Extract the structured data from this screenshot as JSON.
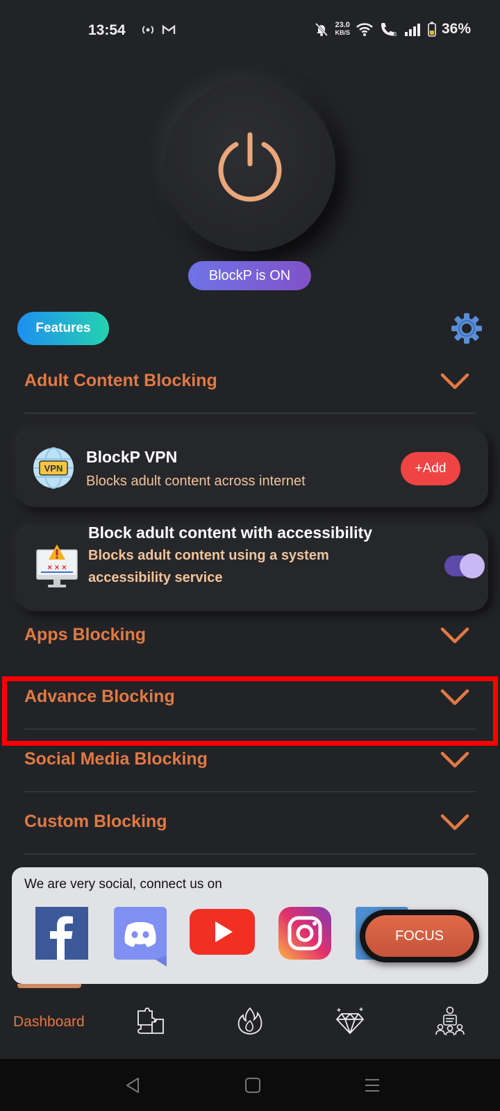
{
  "status_bar": {
    "time": "13:54",
    "left_icons": [
      "radio-icon",
      "gmail-icon"
    ],
    "speed_value": "23.0",
    "speed_unit": "KB/S",
    "battery": "36%",
    "right_icons": [
      "mute-icon",
      "wifi-icon",
      "wifi-calling-icon",
      "signal-icon",
      "battery-icon"
    ]
  },
  "hero": {
    "status_label": "BlockP is ON",
    "power_color": "#e9a77a"
  },
  "features": {
    "label": "Features"
  },
  "sections": [
    {
      "title": "Adult Content Blocking",
      "expanded": true
    },
    {
      "title": "Apps Blocking",
      "expanded": false
    },
    {
      "title": "Advance Blocking",
      "expanded": false,
      "highlighted": true
    },
    {
      "title": "Social Media Blocking",
      "expanded": false
    },
    {
      "title": "Custom Blocking",
      "expanded": false
    }
  ],
  "cards": {
    "vpn": {
      "title": "BlockP VPN",
      "description": "Blocks adult content across internet",
      "icon_text": "VPN",
      "button": "+Add"
    },
    "accessibility": {
      "title": "Block adult content with accessibility",
      "description_line1": "Blocks adult content using a system",
      "description_line2": "accessibility service",
      "toggle_on": true
    }
  },
  "social": {
    "label": "We are very social, connect us on",
    "icons": [
      "facebook-icon",
      "discord-icon",
      "youtube-icon",
      "instagram-icon",
      "linkedin-icon"
    ]
  },
  "focus_button": {
    "label": "FOCUS"
  },
  "bottom_nav": {
    "active_label": "Dashboard",
    "items": [
      "dashboard",
      "puzzle-icon",
      "fire-icon",
      "diamond-icon",
      "community-icon"
    ]
  },
  "colors": {
    "background": "#222326",
    "accent": "#e07a45",
    "description": "#f2c49a",
    "toggle": "#c8b8f3",
    "add_button": "#f04444",
    "highlight": "#ff0000"
  }
}
